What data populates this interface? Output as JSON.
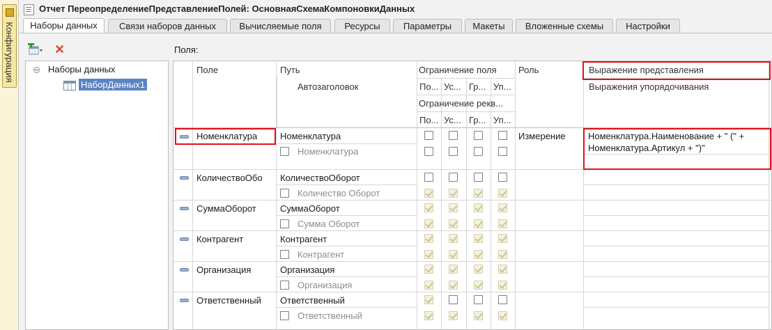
{
  "side_panel": {
    "label": "Конфигурация"
  },
  "window": {
    "title": "Отчет ПереопределениеПредставлениеПолей: ОсновнаяСхемаКомпоновкиДанных"
  },
  "tabs": [
    {
      "label": "Наборы данных",
      "active": true
    },
    {
      "label": "Связи наборов данных"
    },
    {
      "label": "Вычисляемые поля"
    },
    {
      "label": "Ресурсы"
    },
    {
      "label": "Параметры"
    },
    {
      "label": "Макеты"
    },
    {
      "label": "Вложенные схемы"
    },
    {
      "label": "Настройки"
    }
  ],
  "tree": {
    "root": "Наборы данных",
    "child": "НаборДанных1"
  },
  "fields_label": "Поля:",
  "columns": {
    "field": "Поле",
    "path": "Путь",
    "autotitle": "Автозаголовок",
    "field_restriction": "Ограничение поля",
    "attr_restriction": "Ограничение рекв...",
    "sub": [
      "По...",
      "Ус...",
      "Гр...",
      "Уп..."
    ],
    "role": "Роль",
    "presentation_expr": "Выражение представления",
    "order_expr": "Выражения упорядочивания"
  },
  "rows": [
    {
      "field": "Номенклатура",
      "path": "Номенклатура",
      "title": "Номенклатура",
      "role": "Измерение",
      "presentation_line1": "Номенклатура.Наименование + \" (\" +",
      "presentation_line2": "Номенклатура.Артикул + \")\""
    },
    {
      "field": "КоличествоОбо",
      "path": "КоличествоОборот",
      "title": "Количество Оборот"
    },
    {
      "field": "СуммаОборот",
      "path": "СуммаОборот",
      "title": "Сумма Оборот"
    },
    {
      "field": "Контрагент",
      "path": "Контрагент",
      "title": "Контрагент"
    },
    {
      "field": "Организация",
      "path": "Организация",
      "title": "Организация"
    },
    {
      "field": "Ответственный",
      "path": "Ответственный",
      "title": "Ответственный"
    }
  ],
  "colors": {
    "highlight": "#e0101a",
    "selection": "#5b84c4"
  }
}
